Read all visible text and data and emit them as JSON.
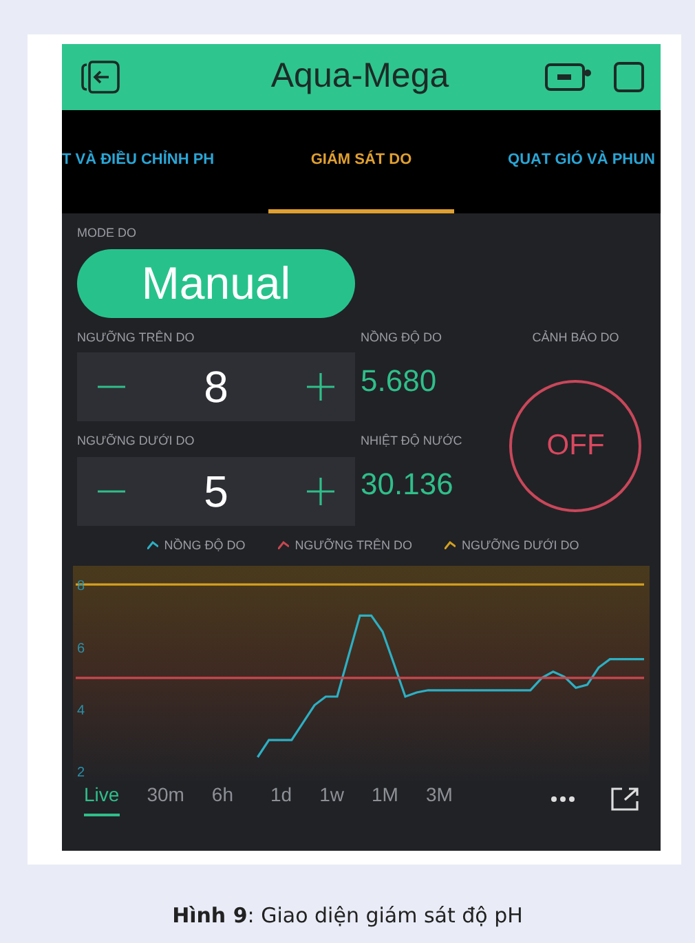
{
  "header": {
    "title": "Aqua-Mega"
  },
  "tabs": [
    {
      "label": "T VÀ ĐIỀU CHỈNH PH",
      "selected": false
    },
    {
      "label": "GIÁM SÁT DO",
      "selected": true
    },
    {
      "label": "QUẠT GIÓ VÀ PHUN",
      "selected": false
    }
  ],
  "mode": {
    "label": "MODE DO",
    "value": "Manual"
  },
  "steppers": [
    {
      "label": "NGƯỠNG TRÊN DO",
      "value": "8"
    },
    {
      "label": "NGƯỠNG DƯỚI DO",
      "value": "5"
    }
  ],
  "displays": [
    {
      "label": "NỒNG ĐỘ DO",
      "value": "5.680"
    },
    {
      "label": "NHIỆT ĐỘ NƯỚC",
      "value": "30.136"
    }
  ],
  "alert": {
    "label": "CẢNH BÁO DO",
    "text": "OFF"
  },
  "chart": {
    "chart_data": {
      "type": "line",
      "series": [
        {
          "name": "NỒNG ĐỘ DO",
          "color": "#2bb0c4",
          "values": [
            null,
            null,
            null,
            null,
            null,
            null,
            null,
            null,
            null,
            null,
            null,
            null,
            null,
            null,
            null,
            null,
            2.45,
            3.0,
            3.0,
            3.0,
            3.56,
            4.12,
            4.4,
            4.4,
            5.7,
            7.0,
            7.0,
            6.48,
            5.44,
            4.4,
            4.53,
            4.6,
            4.6,
            4.6,
            4.6,
            4.6,
            4.6,
            4.6,
            4.6,
            4.6,
            4.6,
            5.0,
            5.2,
            5.03,
            4.68,
            4.78,
            5.33,
            5.6,
            5.6,
            5.6,
            5.6
          ]
        },
        {
          "name": "NGƯỠNG TRÊN DO",
          "color": "#c9474f",
          "values": [
            5,
            5,
            5,
            5,
            5,
            5,
            5,
            5,
            5,
            5,
            5,
            5,
            5,
            5,
            5,
            5,
            5,
            5,
            5,
            5,
            5,
            5,
            5,
            5,
            5,
            5,
            5,
            5,
            5,
            5,
            5,
            5,
            5,
            5,
            5,
            5,
            5,
            5,
            5,
            5,
            5,
            5,
            5,
            5,
            5,
            5,
            5,
            5,
            5,
            5,
            5
          ]
        },
        {
          "name": "NGƯỠNG DƯỚI DO",
          "color": "#d4a020",
          "values": [
            8,
            8,
            8,
            8,
            8,
            8,
            8,
            8,
            8,
            8,
            8,
            8,
            8,
            8,
            8,
            8,
            8,
            8,
            8,
            8,
            8,
            8,
            8,
            8,
            8,
            8,
            8,
            8,
            8,
            8,
            8,
            8,
            8,
            8,
            8,
            8,
            8,
            8,
            8,
            8,
            8,
            8,
            8,
            8,
            8,
            8,
            8,
            8,
            8,
            8,
            8
          ]
        }
      ],
      "ylim": [
        1.7,
        8.6
      ],
      "yticks": [
        2,
        4,
        6,
        8
      ]
    }
  },
  "ranges": [
    {
      "label": "Live",
      "selected": true
    },
    {
      "label": "30m",
      "selected": false
    },
    {
      "label": "6h",
      "selected": false
    },
    {
      "label": "1d",
      "selected": false
    },
    {
      "label": "1w",
      "selected": false
    },
    {
      "label": "1M",
      "selected": false
    },
    {
      "label": "3M",
      "selected": false
    }
  ],
  "caption": "**Hình 9**: Giao diện giám sát độ pH"
}
